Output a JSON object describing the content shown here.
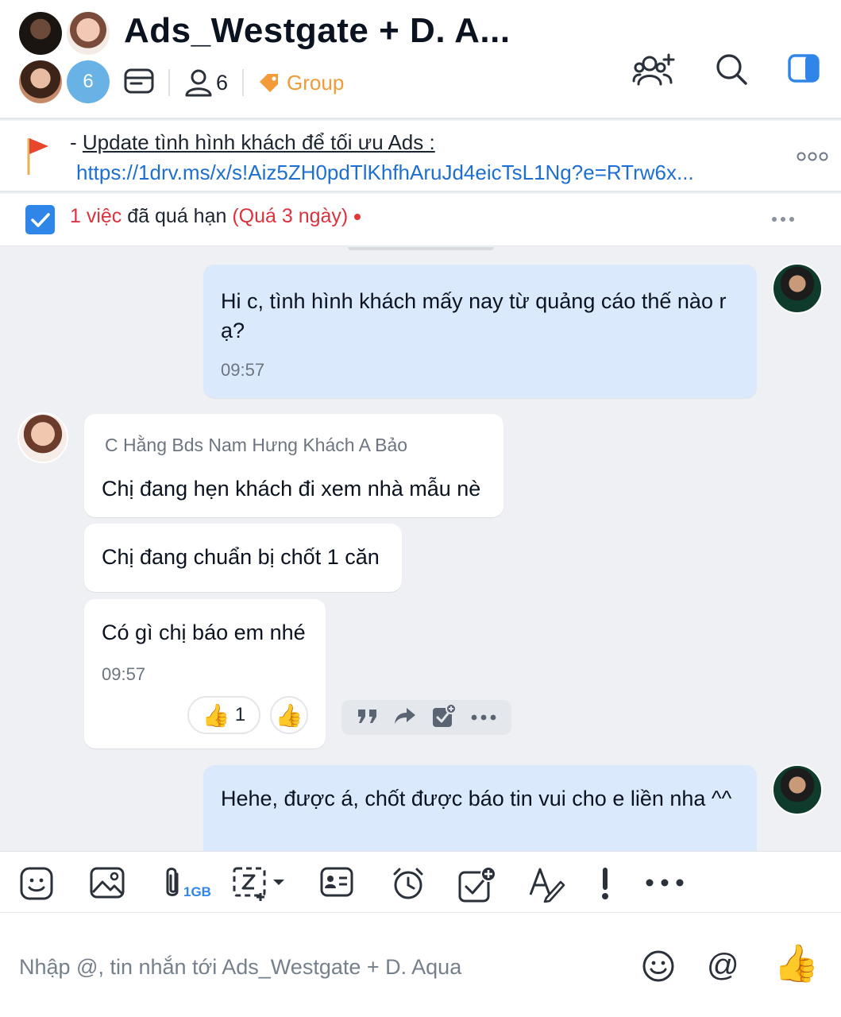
{
  "header": {
    "title": "Ads_Westgate + D. A...",
    "avatar_count": "6",
    "member_count": "6",
    "tag_label": "Group"
  },
  "pinned": {
    "prefix": "- ",
    "text": "Update tình hình khách để tối ưu Ads :",
    "link": "https://1drv.ms/x/s!Aiz5ZH0pdTlKhfhAruJd4eicTsL1Ng?e=RTrw6x..."
  },
  "task": {
    "count": "1 việc",
    "status": " đã quá hạn ",
    "overdue": "(Quá 3 ngày)"
  },
  "messages": [
    {
      "id": "m1",
      "direction": "out",
      "text": "Hi c, tình hình khách mấy nay từ quảng cáo thế nào r ạ?",
      "time": "09:57"
    },
    {
      "id": "m2",
      "direction": "in",
      "sender": "C Hằng Bds Nam Hưng Khách A Bảo",
      "text": "Chị đang hẹn khách đi xem nhà mẫu nè"
    },
    {
      "id": "m3",
      "direction": "in",
      "text": "Chị đang chuẩn bị chốt 1 căn"
    },
    {
      "id": "m4",
      "direction": "in",
      "text": "Có gì chị báo em nhé",
      "time": "09:57",
      "reaction_count": "1"
    },
    {
      "id": "m5",
      "direction": "out",
      "text": "Hehe, được á, chốt được báo tin vui cho e liền nha ^^"
    }
  ],
  "toolbar": {
    "attachment_limit": "1GB",
    "tools": [
      "sticker-icon",
      "image-icon",
      "attachment-icon",
      "screenshot-icon",
      "contact-card-icon",
      "reminder-icon",
      "create-task-icon",
      "text-format-icon",
      "important-icon",
      "more-icon"
    ]
  },
  "composer": {
    "placeholder": "Nhập @, tin nhắn tới Ads_Westgate + D. Aqua"
  },
  "colors": {
    "accent": "#2f86e8",
    "tag": "#f29b38",
    "outgoing_bubble": "#dbe9fd",
    "overdue": "#d9333e",
    "link": "#1d6fd1"
  }
}
